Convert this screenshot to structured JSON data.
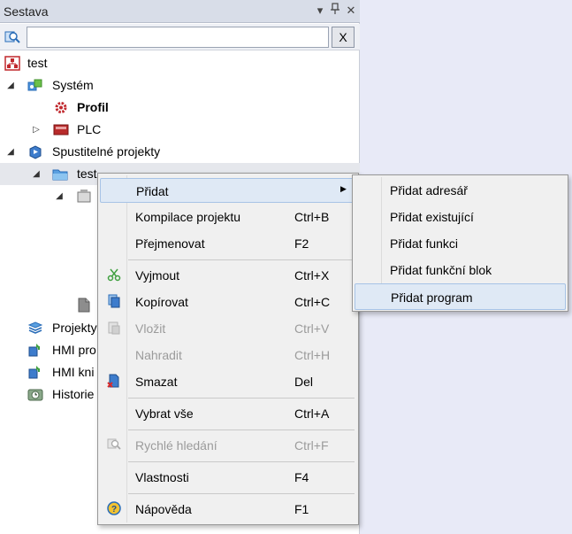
{
  "panel": {
    "title": "Sestava",
    "dropdown_icon": "▾",
    "pin_icon": "📌",
    "close_icon": "✕",
    "search_value": "",
    "clear_label": "X"
  },
  "tree": {
    "root": "test",
    "system": "Systém",
    "profil": "Profil",
    "plc": "PLC",
    "spustitelne": "Spustitelné projekty",
    "test_child": "test",
    "projekty": "Projekty",
    "hmi_pro": "HMI pro",
    "hmi_kni": "HMI kni",
    "historie": "Historie"
  },
  "context_menu": {
    "items": [
      {
        "label": "Přidat",
        "shortcut": ""
      },
      {
        "label": "Kompilace projektu",
        "shortcut": "Ctrl+B"
      },
      {
        "label": "Přejmenovat",
        "shortcut": "F2"
      },
      {
        "label": "Vyjmout",
        "shortcut": "Ctrl+X"
      },
      {
        "label": "Kopírovat",
        "shortcut": "Ctrl+C"
      },
      {
        "label": "Vložit",
        "shortcut": "Ctrl+V"
      },
      {
        "label": "Nahradit",
        "shortcut": "Ctrl+H"
      },
      {
        "label": "Smazat",
        "shortcut": "Del"
      },
      {
        "label": "Vybrat vše",
        "shortcut": "Ctrl+A"
      },
      {
        "label": "Rychlé hledání",
        "shortcut": "Ctrl+F"
      },
      {
        "label": "Vlastnosti",
        "shortcut": "F4"
      },
      {
        "label": "Nápověda",
        "shortcut": "F1"
      }
    ]
  },
  "submenu": {
    "items": [
      {
        "label": "Přidat adresář"
      },
      {
        "label": "Přidat existující"
      },
      {
        "label": "Přidat funkci"
      },
      {
        "label": "Přidat funkční blok"
      },
      {
        "label": "Přidat program"
      }
    ]
  },
  "colors": {
    "hover_bg": "#dfe9f5",
    "hover_border": "#a7c3e6",
    "disabled_text": "#9b9b9b"
  }
}
